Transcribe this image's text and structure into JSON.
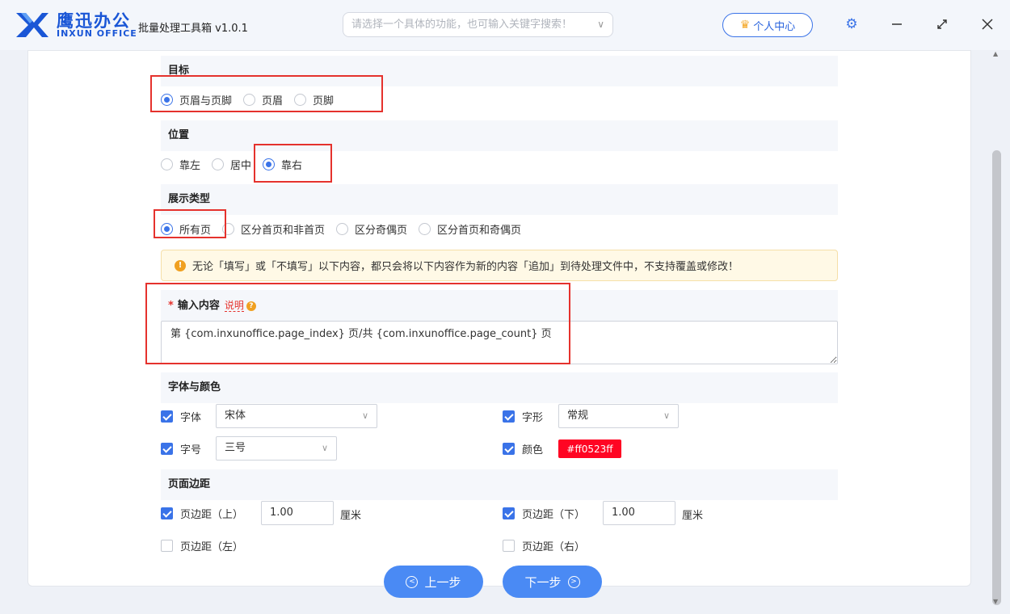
{
  "brand": {
    "name_cn": "鹰迅办公",
    "name_en": "INXUN OFFICE",
    "logo_color": "#1a56d6"
  },
  "app": {
    "title": "批量处理工具箱 v1.0.1"
  },
  "search": {
    "placeholder": "请选择一个具体的功能，也可输入关键字搜索！"
  },
  "header": {
    "user_center": "个人中心"
  },
  "sections": {
    "target": {
      "title": "目标",
      "options": [
        "页眉与页脚",
        "页眉",
        "页脚"
      ],
      "selected": "页眉与页脚"
    },
    "position": {
      "title": "位置",
      "options": [
        "靠左",
        "居中",
        "靠右"
      ],
      "selected": "靠右"
    },
    "display_type": {
      "title": "展示类型",
      "options": [
        "所有页",
        "区分首页和非首页",
        "区分奇偶页",
        "区分首页和奇偶页"
      ],
      "selected": "所有页"
    },
    "notice": "无论「填写」或「不填写」以下内容，都只会将以下内容作为新的内容「追加」到待处理文件中，不支持覆盖或修改！",
    "content": {
      "required_mark": "*",
      "title": "输入内容",
      "help_link": "说明",
      "value": "第 {com.inxunoffice.page_index} 页/共 {com.inxunoffice.page_count} 页"
    },
    "font": {
      "title": "字体与颜色",
      "font_family": {
        "label": "字体",
        "checked": true,
        "value": "宋体"
      },
      "font_style": {
        "label": "字形",
        "checked": true,
        "value": "常规"
      },
      "font_size": {
        "label": "字号",
        "checked": true,
        "value": "三号"
      },
      "color": {
        "label": "颜色",
        "checked": true,
        "value": "#ff0523ff",
        "swatch": "#ff0523"
      }
    },
    "margins": {
      "title": "页面边距",
      "top": {
        "label": "页边距（上）",
        "checked": true,
        "value": "1.00",
        "unit": "厘米"
      },
      "bottom": {
        "label": "页边距（下）",
        "checked": true,
        "value": "1.00",
        "unit": "厘米"
      },
      "left": {
        "label": "页边距（左）",
        "checked": false
      },
      "right": {
        "label": "页边距（右）",
        "checked": false
      }
    }
  },
  "footer": {
    "prev": "上一步",
    "next": "下一步"
  },
  "colors": {
    "accent": "#3a73e8",
    "button": "#4a8af4",
    "highlight": "#e5322d"
  }
}
